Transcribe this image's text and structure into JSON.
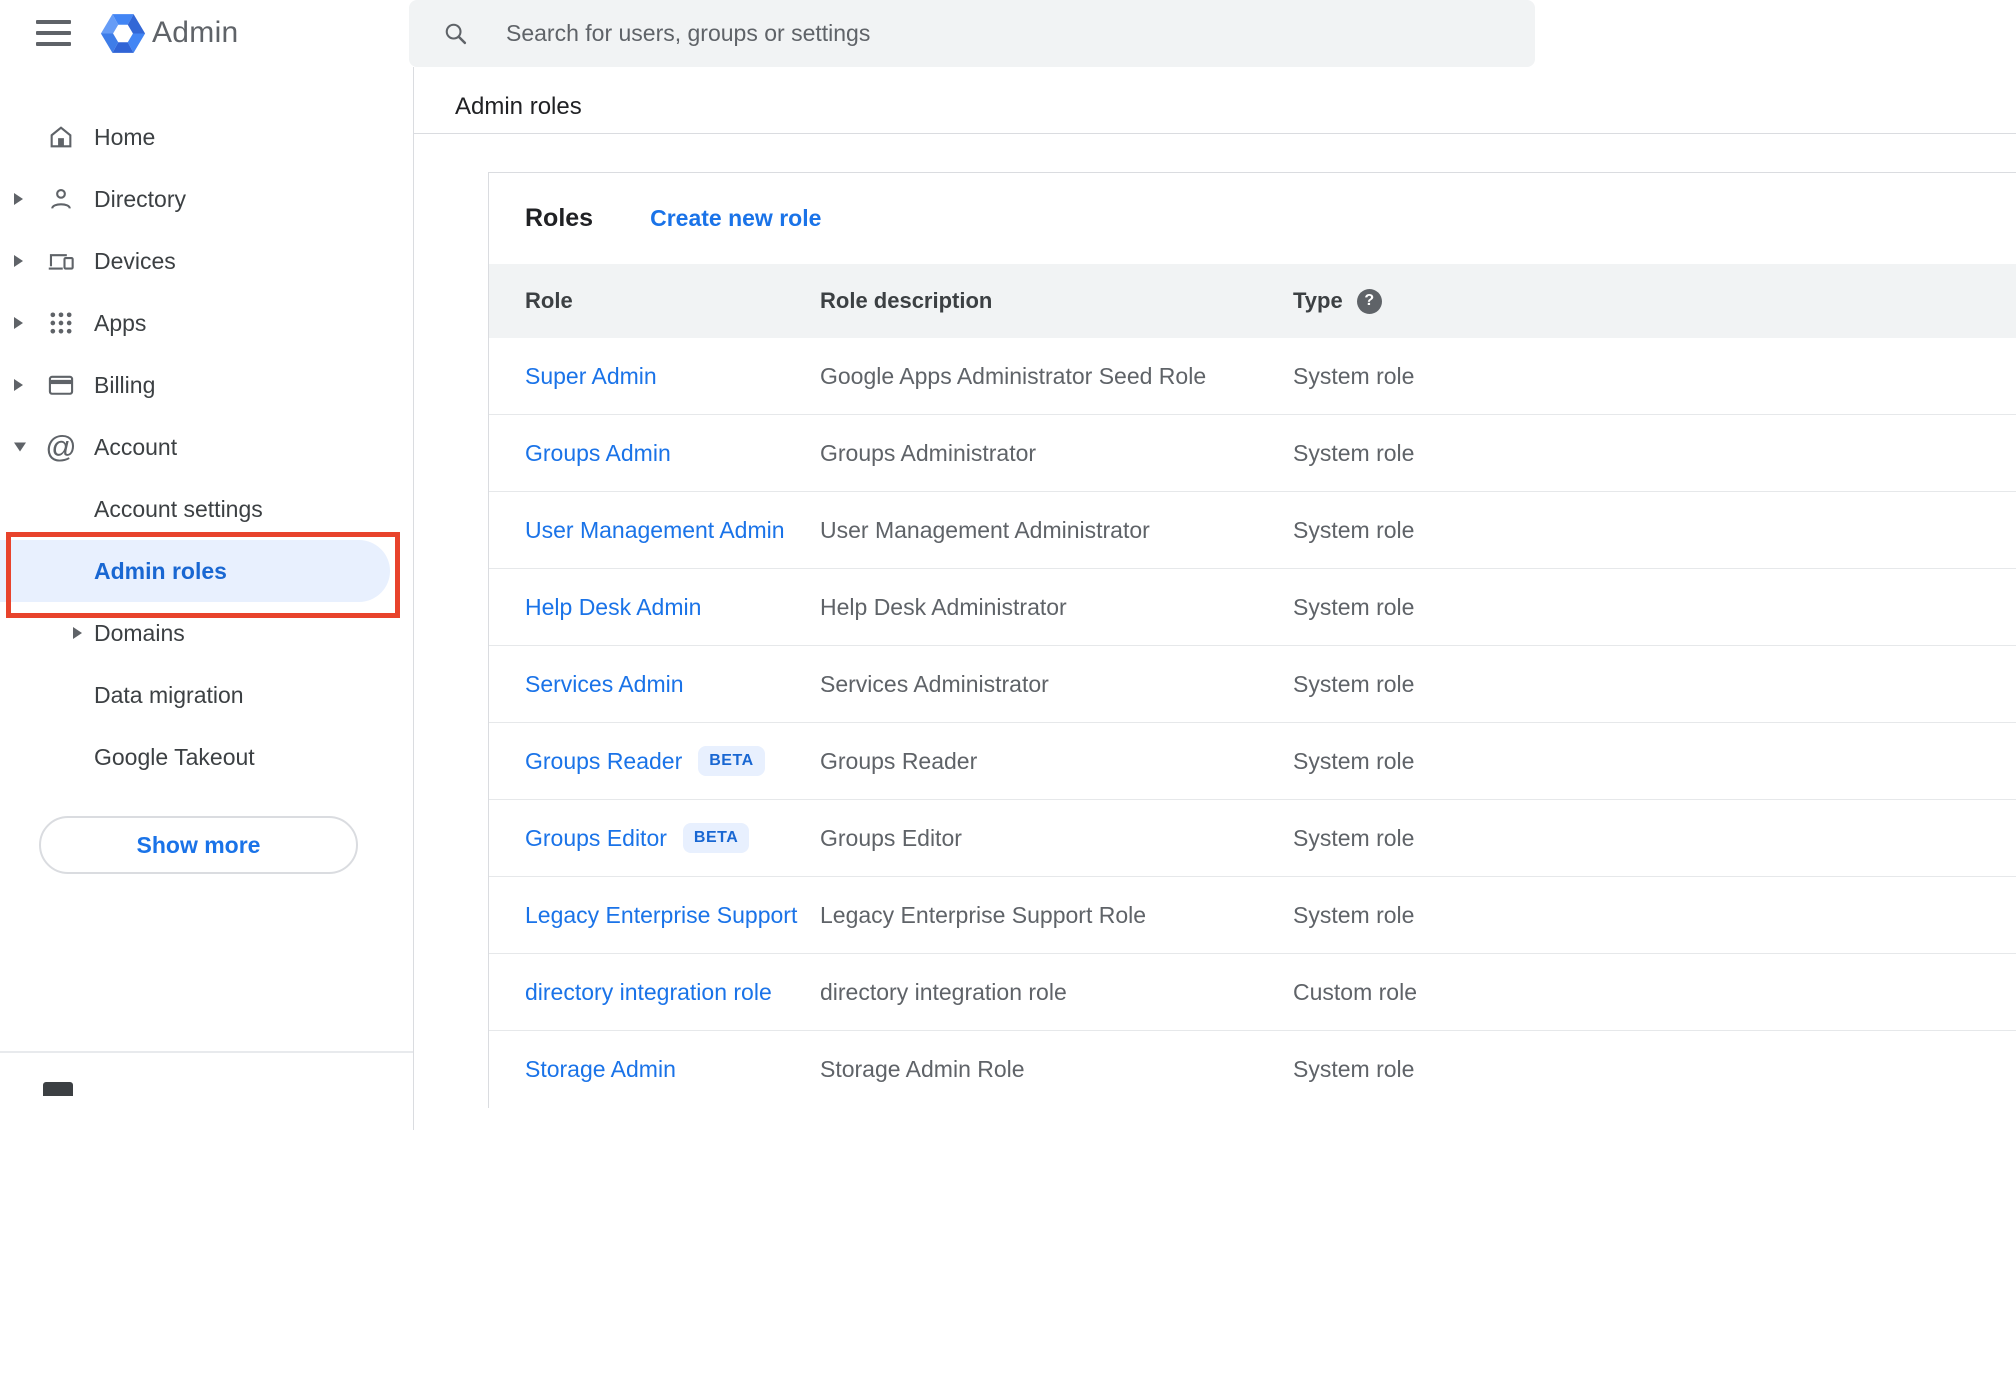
{
  "topbar": {
    "product_name": "Admin",
    "search_placeholder": "Search for users, groups or settings"
  },
  "breadcrumb": "Admin roles",
  "sidebar": {
    "items": [
      {
        "label": "Home",
        "icon": "home",
        "arrow": "none",
        "indent": false,
        "selected": false
      },
      {
        "label": "Directory",
        "icon": "person",
        "arrow": "right",
        "indent": false,
        "selected": false
      },
      {
        "label": "Devices",
        "icon": "devices",
        "arrow": "right",
        "indent": false,
        "selected": false
      },
      {
        "label": "Apps",
        "icon": "apps",
        "arrow": "right",
        "indent": false,
        "selected": false
      },
      {
        "label": "Billing",
        "icon": "card",
        "arrow": "right",
        "indent": false,
        "selected": false
      },
      {
        "label": "Account",
        "icon": "at",
        "arrow": "down",
        "indent": false,
        "selected": false
      },
      {
        "label": "Account settings",
        "icon": null,
        "arrow": "none",
        "indent": true,
        "selected": false
      },
      {
        "label": "Admin roles",
        "icon": null,
        "arrow": "none",
        "indent": true,
        "selected": true
      },
      {
        "label": "Domains",
        "icon": null,
        "arrow": "right",
        "arrow_indent": true,
        "indent": true,
        "selected": false
      },
      {
        "label": "Data migration",
        "icon": null,
        "arrow": "none",
        "indent": true,
        "selected": false
      },
      {
        "label": "Google Takeout",
        "icon": null,
        "arrow": "none",
        "indent": true,
        "selected": false
      }
    ],
    "show_more_label": "Show more"
  },
  "roles_panel": {
    "title": "Roles",
    "create_link": "Create new role",
    "columns": {
      "role": "Role",
      "description": "Role description",
      "type": "Type"
    },
    "beta_label": "BETA",
    "rows": [
      {
        "role": "Super Admin",
        "beta": false,
        "description": "Google Apps Administrator Seed Role",
        "type": "System role"
      },
      {
        "role": "Groups Admin",
        "beta": false,
        "description": "Groups Administrator",
        "type": "System role"
      },
      {
        "role": "User Management Admin",
        "beta": false,
        "description": "User Management Administrator",
        "type": "System role"
      },
      {
        "role": "Help Desk Admin",
        "beta": false,
        "description": "Help Desk Administrator",
        "type": "System role"
      },
      {
        "role": "Services Admin",
        "beta": false,
        "description": "Services Administrator",
        "type": "System role"
      },
      {
        "role": "Groups Reader",
        "beta": true,
        "description": "Groups Reader",
        "type": "System role"
      },
      {
        "role": "Groups Editor",
        "beta": true,
        "description": "Groups Editor",
        "type": "System role"
      },
      {
        "role": "Legacy Enterprise Support",
        "beta": false,
        "description": "Legacy Enterprise Support Role",
        "type": "System role"
      },
      {
        "role": "directory integration role",
        "beta": false,
        "description": "directory integration role",
        "type": "Custom role"
      },
      {
        "role": "Storage Admin",
        "beta": false,
        "description": "Storage Admin Role",
        "type": "System role"
      }
    ]
  },
  "colors": {
    "link_blue": "#1a73e8",
    "selected_blue": "#1967d2",
    "selected_bg": "#e8f0fe",
    "annotation_red": "#e8432c",
    "header_band": "#f1f3f4",
    "border_gray": "#dadce0",
    "text_gray": "#5f6368",
    "text_dark": "#202124"
  }
}
